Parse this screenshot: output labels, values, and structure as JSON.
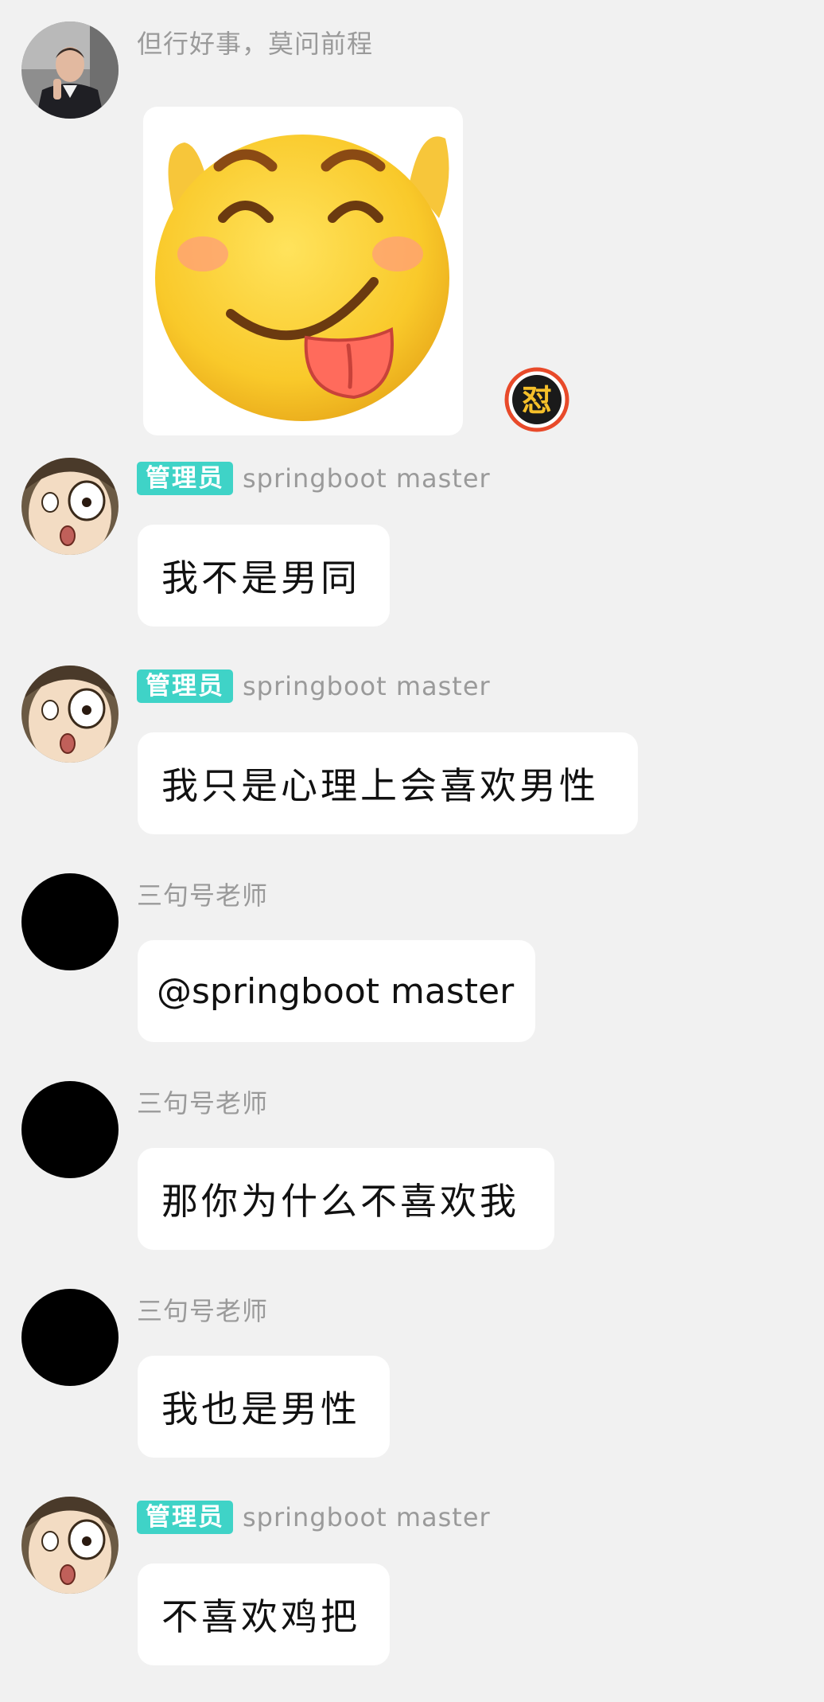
{
  "messages": [
    {
      "sender": "但行好事，莫问前程",
      "avatar": "man-in-suit-photo",
      "content_type": "sticker",
      "sticker": "tongue-out-smiley-emoji",
      "reaction": {
        "icon": "dui-reaction-icon",
        "glyph": "怼"
      }
    },
    {
      "badge": "管理员",
      "sender": "springboot master",
      "avatar": "anime-boy-shocked",
      "text": "我不是男同"
    },
    {
      "badge": "管理员",
      "sender": "springboot master",
      "avatar": "anime-boy-shocked",
      "text": "我只是心理上会喜欢男性"
    },
    {
      "sender": "三句号老师",
      "avatar": "black-circle-avatar",
      "text": "@springboot master"
    },
    {
      "sender": "三句号老师",
      "avatar": "black-circle-avatar",
      "text": "那你为什么不喜欢我"
    },
    {
      "sender": "三句号老师",
      "avatar": "black-circle-avatar",
      "text": "我也是男性"
    },
    {
      "badge": "管理员",
      "sender": "springboot master",
      "avatar": "anime-boy-shocked",
      "text": "不喜欢鸡把"
    }
  ],
  "colors": {
    "background": "#f1f1f1",
    "bubble": "#ffffff",
    "admin_badge": "#3fd3c7",
    "sender_name": "#9a9a9a"
  }
}
